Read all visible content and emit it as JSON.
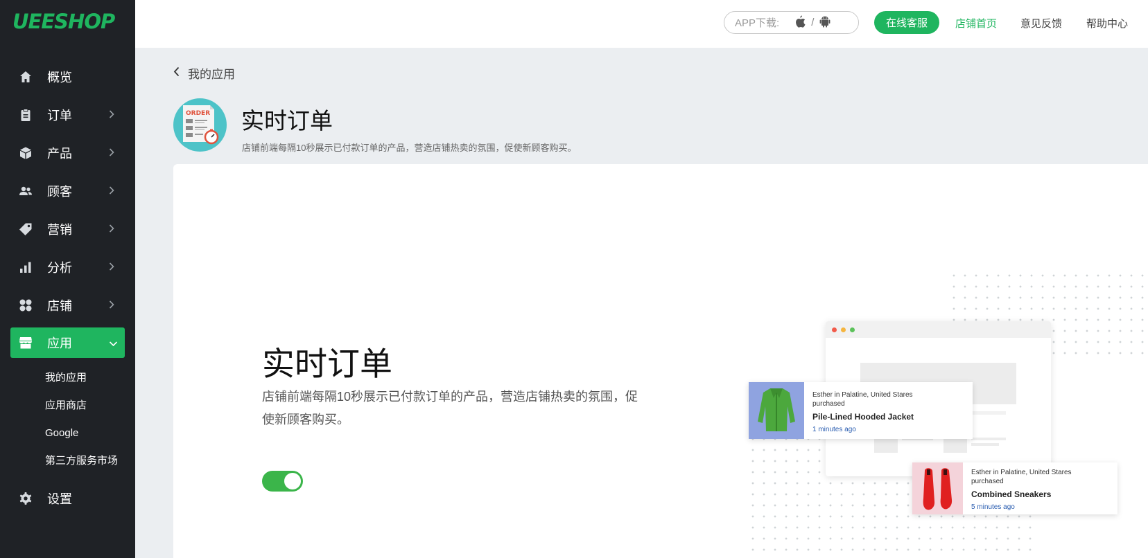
{
  "brand": {
    "logo": "UEESHOP",
    "accent": "#1fb55f"
  },
  "sidebar": {
    "items": [
      {
        "label": "概览",
        "icon": "home-icon"
      },
      {
        "label": "订单",
        "icon": "clipboard-icon"
      },
      {
        "label": "产品",
        "icon": "box-icon"
      },
      {
        "label": "顾客",
        "icon": "users-icon"
      },
      {
        "label": "营销",
        "icon": "tag-icon"
      },
      {
        "label": "分析",
        "icon": "bar-chart-icon"
      },
      {
        "label": "店铺",
        "icon": "grid-icon"
      },
      {
        "label": "应用",
        "icon": "store-icon",
        "active": true
      },
      {
        "label": "设置",
        "icon": "gear-icon"
      }
    ],
    "sub_items": [
      "我的应用",
      "应用商店",
      "Google",
      "第三方服务市场"
    ]
  },
  "topbar": {
    "app_download_label": "APP下载:",
    "app_download_separator": "/",
    "support_label": "在线客服",
    "store_home_label": "店铺首页",
    "feedback_label": "意见反馈",
    "help_label": "帮助中心"
  },
  "header": {
    "back_label": "我的应用",
    "icon_text": "ORDER",
    "title": "实时订单",
    "description": "店铺前端每隔10秒展示已付款订单的产品，营造店铺热卖的氛围，促使新顾客购买。"
  },
  "card": {
    "title": "实时订单",
    "description": "店铺前端每隔10秒展示已付款订单的产品，营造店铺热卖的氛围，促使新顾客购买。",
    "toggle_on": true
  },
  "preview": {
    "notifications": [
      {
        "who": "Esther in Palatine, United Stares purchased",
        "product": "Pile-Lined Hooded Jacket",
        "time": "1 minutes ago"
      },
      {
        "who": "Esther in Palatine, United Stares purchased",
        "product": "Combined Sneakers",
        "time": "5 minutes ago"
      }
    ]
  }
}
